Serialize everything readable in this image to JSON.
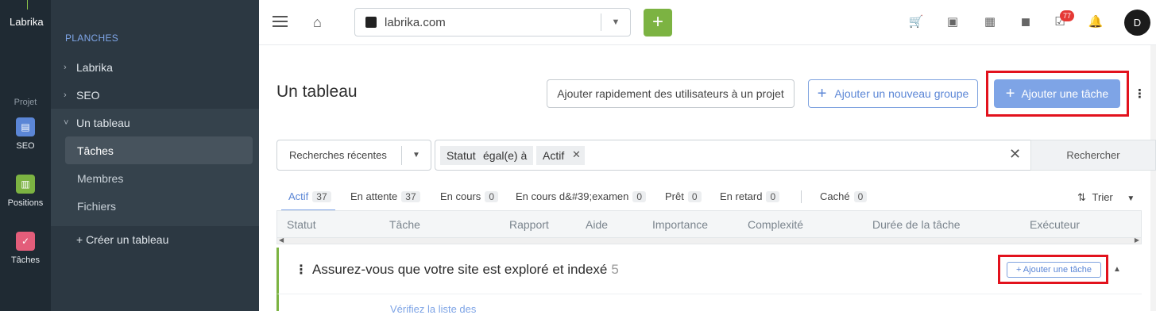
{
  "rail": {
    "brand": "Labrika",
    "section_label": "Projet",
    "items": [
      {
        "label": "SEO",
        "icon": "clipboard-icon",
        "color": "#5b86d6"
      },
      {
        "label": "Positions",
        "icon": "chart-icon",
        "color": "#7cb342"
      },
      {
        "label": "Tâches",
        "icon": "check-icon",
        "color": "#e35d7a"
      }
    ]
  },
  "sidebar": {
    "heading": "PLANCHES",
    "boards": [
      "Labrika",
      "SEO",
      "Un tableau"
    ],
    "sub_items": [
      "Tâches",
      "Membres",
      "Fichiers"
    ],
    "create_label": "+ Créer un tableau"
  },
  "topbar": {
    "site": "labrika.com",
    "notification_count": "77",
    "avatar_letter": "D"
  },
  "page": {
    "title": "Un tableau",
    "btn_quick_users": "Ajouter rapidement des utilisateurs à un projet",
    "btn_new_group": "Ajouter un nouveau groupe",
    "btn_add_task": "Ajouter une tâche"
  },
  "filter": {
    "recent_label": "Recherches récentes",
    "chips": [
      "Statut",
      "égal(e) à",
      "Actif"
    ],
    "search_button": "Rechercher"
  },
  "tabs": [
    {
      "label": "Actif",
      "count": "37"
    },
    {
      "label": "En attente",
      "count": "37"
    },
    {
      "label": "En cours",
      "count": "0"
    },
    {
      "label": "En cours d&#39;examen",
      "count": "0"
    },
    {
      "label": "Prêt",
      "count": "0"
    },
    {
      "label": "En retard",
      "count": "0"
    },
    {
      "label": "Caché",
      "count": "0"
    }
  ],
  "sort_label": "Trier",
  "columns": [
    "Statut",
    "Tâche",
    "Rapport",
    "Aide",
    "Importance",
    "Complexité",
    "Durée de la tâche",
    "Exécuteur"
  ],
  "group": {
    "title": "Assurez-vous que votre site est exploré et indexé",
    "count": "5",
    "add_button": "+ Ajouter une tâche",
    "first_task": "Vérifiez la liste des"
  },
  "colors": {
    "accent_blue": "#7ea4e6",
    "accent_green": "#7cb342",
    "highlight_red": "#e2121d"
  }
}
